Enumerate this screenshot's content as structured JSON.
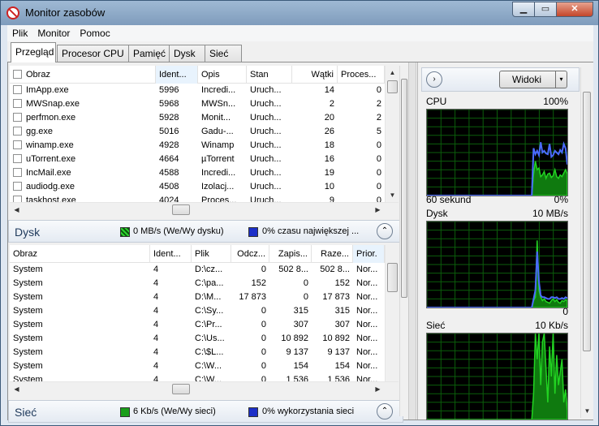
{
  "window": {
    "title": "Monitor zasobów",
    "minimize": "▁",
    "maximize": "▭",
    "close": "✕"
  },
  "menu": [
    "Plik",
    "Monitor",
    "Pomoc"
  ],
  "tabs": [
    "Przegląd",
    "Procesor CPU",
    "Pamięć",
    "Dysk",
    "Sieć"
  ],
  "cpu_table": {
    "columns": [
      "Obraz",
      "Ident...",
      "Opis",
      "Stan",
      "Wątki",
      "Proces..."
    ],
    "rows": [
      [
        "ImApp.exe",
        "5996",
        "Incredi...",
        "Uruch...",
        "14",
        "0"
      ],
      [
        "MWSnap.exe",
        "5968",
        "MWSn...",
        "Uruch...",
        "2",
        "2"
      ],
      [
        "perfmon.exe",
        "5928",
        "Monit...",
        "Uruch...",
        "20",
        "2"
      ],
      [
        "gg.exe",
        "5016",
        "Gadu-...",
        "Uruch...",
        "26",
        "5"
      ],
      [
        "winamp.exe",
        "4928",
        "Winamp",
        "Uruch...",
        "18",
        "0"
      ],
      [
        "uTorrent.exe",
        "4664",
        "µTorrent",
        "Uruch...",
        "16",
        "0"
      ],
      [
        "IncMail.exe",
        "4588",
        "Incredi...",
        "Uruch...",
        "19",
        "0"
      ],
      [
        "audiodg.exe",
        "4508",
        "Izolacj...",
        "Uruch...",
        "10",
        "0"
      ],
      [
        "taskhost.exe",
        "4024",
        "Proces...",
        "Uruch...",
        "9",
        "0"
      ]
    ]
  },
  "disk_section": {
    "title": "Dysk",
    "stat1": "0 MB/s (We/Wy dysku)",
    "stat2": "0% czasu największej ...",
    "collapse": "⌃",
    "columns": [
      "Obraz",
      "Ident...",
      "Plik",
      "Odcz...",
      "Zapis...",
      "Raze...",
      "Prior."
    ],
    "rows": [
      [
        "System",
        "4",
        "D:\\cz...",
        "0",
        "502 8...",
        "502 8...",
        "Nor..."
      ],
      [
        "System",
        "4",
        "C:\\pa...",
        "152",
        "0",
        "152",
        "Nor..."
      ],
      [
        "System",
        "4",
        "D:\\M...",
        "17 873",
        "0",
        "17 873",
        "Nor..."
      ],
      [
        "System",
        "4",
        "C:\\Sy...",
        "0",
        "315",
        "315",
        "Nor..."
      ],
      [
        "System",
        "4",
        "C:\\Pr...",
        "0",
        "307",
        "307",
        "Nor..."
      ],
      [
        "System",
        "4",
        "C:\\Us...",
        "0",
        "10 892",
        "10 892",
        "Nor..."
      ],
      [
        "System",
        "4",
        "C:\\$L...",
        "0",
        "9 137",
        "9 137",
        "Nor..."
      ],
      [
        "System",
        "4",
        "C:\\W...",
        "0",
        "154",
        "154",
        "Nor..."
      ],
      [
        "System",
        "4",
        "C:\\W...",
        "0",
        "1 536",
        "1 536",
        "Nor..."
      ]
    ]
  },
  "net_section": {
    "title": "Sieć",
    "stat1": "6 Kb/s (We/Wy sieci)",
    "stat2": "0% wykorzystania sieci",
    "collapse": "⌃"
  },
  "right_panel": {
    "forward": "›",
    "views_label": "Widoki",
    "dropdown": "▾",
    "graphs": [
      {
        "name": "CPU",
        "max": "100%",
        "footer_left": "60 sekund",
        "footer_right": "0%",
        "green": [
          0,
          0,
          0,
          0,
          0,
          0,
          0,
          0,
          0,
          0,
          0,
          0,
          0,
          0,
          0,
          0,
          0,
          0,
          0,
          0,
          0,
          0,
          0,
          0,
          0,
          0,
          0,
          0,
          0,
          0,
          0,
          0,
          0,
          0,
          0,
          0,
          0,
          0,
          0,
          0,
          0,
          0,
          0,
          0,
          0,
          0,
          0,
          0,
          0,
          0,
          0,
          0,
          0,
          0,
          0,
          0,
          0,
          0,
          0,
          0,
          25,
          40,
          30,
          32,
          22,
          24,
          28,
          20,
          25,
          26,
          21,
          23,
          30,
          22,
          20,
          24,
          22,
          26,
          30,
          25
        ],
        "blue": [
          0,
          0,
          0,
          0,
          0,
          0,
          0,
          0,
          0,
          0,
          0,
          0,
          0,
          0,
          0,
          0,
          0,
          0,
          0,
          0,
          0,
          0,
          0,
          0,
          0,
          0,
          0,
          0,
          0,
          0,
          0,
          0,
          0,
          0,
          0,
          0,
          0,
          0,
          0,
          0,
          0,
          0,
          0,
          0,
          0,
          0,
          0,
          0,
          0,
          0,
          0,
          0,
          0,
          0,
          0,
          0,
          0,
          0,
          0,
          0,
          55,
          48,
          52,
          47,
          62,
          50,
          52,
          49,
          48,
          60,
          45,
          47,
          52,
          50,
          48,
          53,
          50,
          60,
          55,
          36
        ]
      },
      {
        "name": "Dysk",
        "max": "10 MB/s",
        "footer_left": "",
        "footer_right": "0",
        "green": [
          0,
          0,
          0,
          0,
          0,
          0,
          0,
          0,
          0,
          0,
          0,
          0,
          0,
          0,
          0,
          0,
          0,
          0,
          0,
          0,
          0,
          0,
          0,
          0,
          0,
          0,
          0,
          0,
          0,
          0,
          0,
          0,
          0,
          0,
          0,
          0,
          0,
          0,
          0,
          0,
          0,
          0,
          0,
          0,
          0,
          0,
          0,
          0,
          0,
          0,
          0,
          0,
          0,
          0,
          0,
          0,
          0,
          0,
          0,
          0,
          8,
          12,
          78,
          20,
          12,
          8,
          10,
          7,
          6,
          5,
          8,
          10,
          7,
          9,
          6,
          5,
          8,
          7,
          9,
          8
        ],
        "blue": [
          0,
          0,
          0,
          0,
          0,
          0,
          0,
          0,
          0,
          0,
          0,
          0,
          0,
          0,
          0,
          0,
          0,
          0,
          0,
          0,
          0,
          0,
          0,
          0,
          0,
          0,
          0,
          0,
          0,
          0,
          0,
          0,
          0,
          0,
          0,
          0,
          0,
          0,
          0,
          0,
          0,
          0,
          0,
          0,
          0,
          0,
          0,
          0,
          0,
          0,
          0,
          0,
          0,
          0,
          0,
          0,
          0,
          0,
          0,
          0,
          10,
          20,
          65,
          30,
          14,
          12,
          12,
          11,
          10,
          10,
          12,
          12,
          11,
          12,
          10,
          10,
          11,
          10,
          12,
          11
        ]
      },
      {
        "name": "Sieć",
        "max": "10 Kb/s",
        "footer_left": "",
        "footer_right": "",
        "green": [
          0,
          0,
          0,
          0,
          0,
          0,
          0,
          0,
          0,
          0,
          0,
          0,
          0,
          0,
          0,
          0,
          0,
          0,
          0,
          0,
          0,
          0,
          0,
          0,
          0,
          0,
          0,
          0,
          0,
          0,
          0,
          0,
          0,
          0,
          0,
          0,
          0,
          0,
          0,
          0,
          0,
          0,
          0,
          0,
          0,
          0,
          0,
          0,
          0,
          0,
          0,
          0,
          0,
          0,
          0,
          0,
          0,
          0,
          0,
          0,
          30,
          100,
          70,
          100,
          40,
          90,
          100,
          60,
          20,
          85,
          50,
          100,
          30,
          75,
          40,
          55,
          70,
          20,
          35,
          10
        ],
        "blue": []
      }
    ]
  },
  "colors": {
    "graph_green": "#22d322",
    "graph_fill": "#0f7a0f",
    "graph_blue": "#4a6bff",
    "grid": "#0b5e0b"
  }
}
